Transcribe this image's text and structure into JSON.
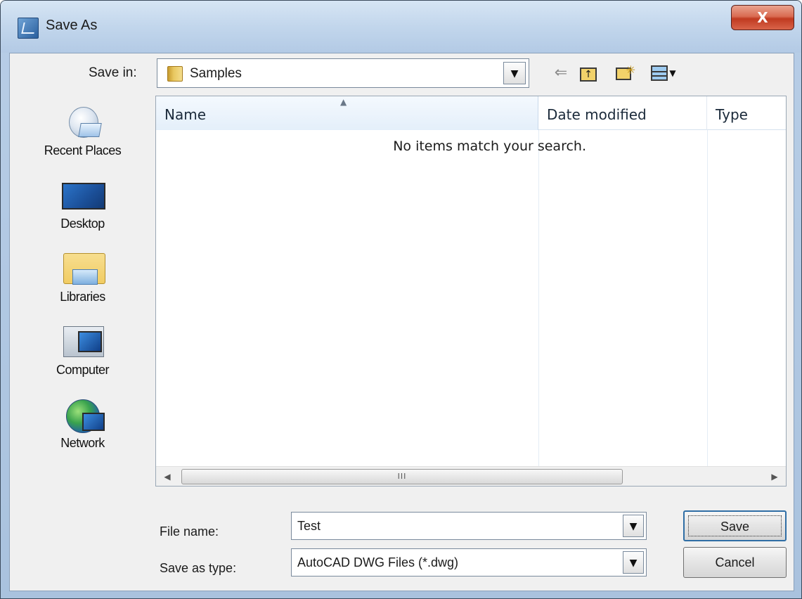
{
  "window": {
    "title": "Save As",
    "close_label": "X"
  },
  "toolbar": {
    "save_in_label": "Save in:",
    "save_in_value": "Samples",
    "icons": [
      "back-icon",
      "up-folder-icon",
      "new-folder-icon",
      "views-menu-icon"
    ]
  },
  "places": [
    {
      "label": "Recent Places",
      "icon": "recent-places-icon"
    },
    {
      "label": "Desktop",
      "icon": "desktop-icon"
    },
    {
      "label": "Libraries",
      "icon": "libraries-icon"
    },
    {
      "label": "Computer",
      "icon": "computer-icon"
    },
    {
      "label": "Network",
      "icon": "network-icon"
    }
  ],
  "file_list": {
    "columns": [
      "Name",
      "Date modified",
      "Type"
    ],
    "empty_message": "No items match your search.",
    "scroll_thumb_grip": "III"
  },
  "form": {
    "file_name_label": "File name:",
    "file_name_value": "Test",
    "save_as_type_label": "Save as type:",
    "save_as_type_value": "AutoCAD DWG Files (*.dwg)"
  },
  "buttons": {
    "save_label": "Save",
    "cancel_label": "Cancel"
  },
  "colors": {
    "titlebar": "#c2d6ec",
    "close_button": "#c03a20",
    "header_highlight": "#e4effa"
  }
}
